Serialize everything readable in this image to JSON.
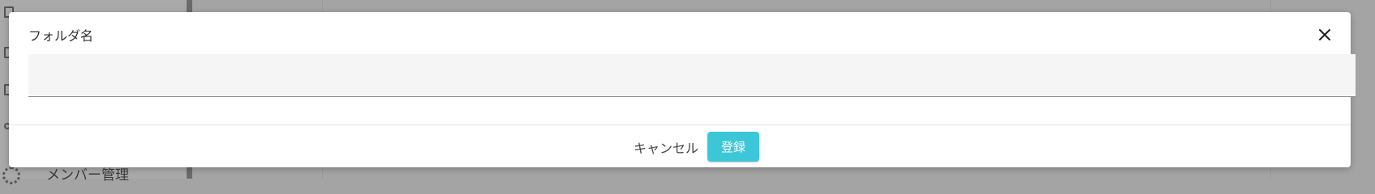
{
  "background": {
    "sidebar_member_label": "メンバー管理"
  },
  "dialog": {
    "field_label": "フォルダ名",
    "field_value": "",
    "field_placeholder": "",
    "close_icon": "close-icon",
    "cancel_label": "キャンセル",
    "submit_label": "登録"
  },
  "colors": {
    "overlay": "#a4a4a4",
    "submit_button": "#3cc7d9",
    "field_background": "#f5f5f5"
  }
}
